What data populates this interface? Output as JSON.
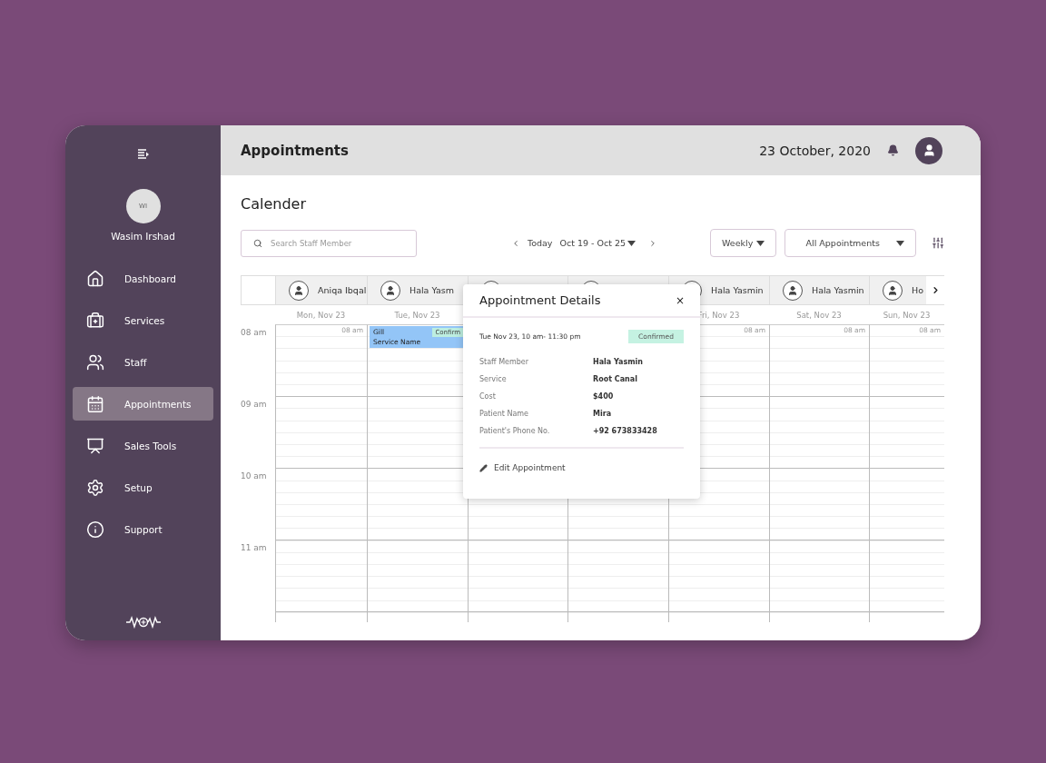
{
  "sidebar": {
    "user": {
      "initials": "WI",
      "name": "Wasim Irshad"
    },
    "items": [
      {
        "label": "Dashboard",
        "selected": false
      },
      {
        "label": "Services",
        "selected": false
      },
      {
        "label": "Staff",
        "selected": false
      },
      {
        "label": "Appointments",
        "selected": true
      },
      {
        "label": "Sales Tools",
        "selected": false
      },
      {
        "label": "Setup",
        "selected": false
      },
      {
        "label": "Support",
        "selected": false
      }
    ]
  },
  "header": {
    "title": "Appointments",
    "date": "23 October, 2020"
  },
  "page_title": "Calender",
  "toolbar": {
    "search": {
      "placeholder": "Search Staff Member"
    },
    "today": "Today",
    "range": "Oct 19 - Oct 25",
    "view": "Weekly",
    "filter": "All Appointments"
  },
  "calendar": {
    "staff": [
      {
        "kind": "named",
        "name": "Aniqa Ibqal"
      },
      {
        "kind": "named",
        "name": "Hala Yasm"
      },
      {
        "kind": "covered"
      },
      {
        "kind": "covered"
      },
      {
        "kind": "named",
        "name": "Hala Yasmin"
      },
      {
        "kind": "named",
        "name": "Hala Yasmin"
      },
      {
        "kind": "named",
        "name": "Ho"
      }
    ],
    "days": [
      {
        "kind": "visible",
        "label": "Mon, Nov 23",
        "slot_label": "08 am"
      },
      {
        "kind": "visible",
        "label": "Tue, Nov 23",
        "events": [
          {
            "title": "Gill",
            "service": "Service Name",
            "status": "Confirm"
          }
        ]
      },
      {
        "kind": "covered"
      },
      {
        "kind": "covered"
      },
      {
        "kind": "visible",
        "label": "Fri, Nov 23",
        "slot_label": "08 am"
      },
      {
        "kind": "visible",
        "label": "Sat, Nov 23",
        "slot_label": "08 am"
      },
      {
        "kind": "visible",
        "label": "Sun, Nov 23",
        "slot_label": "08 am"
      }
    ],
    "hours": [
      "08 am",
      "09 am",
      "10 am",
      "11 am"
    ]
  },
  "popup": {
    "title": "Appointment Details",
    "close": "×",
    "when": "Tue Nov 23, 10 am- 11:30 pm",
    "status": "Confirmed",
    "fields": [
      {
        "label": "Staff Member",
        "value": "Hala Yasmin"
      },
      {
        "label": "Service",
        "value": "Root Canal"
      },
      {
        "label": "Cost",
        "value": "$400"
      },
      {
        "label": "Patient Name",
        "value": "Mira"
      },
      {
        "label": "Patient's Phone No.",
        "value": "+92 673833428"
      }
    ],
    "action": "Edit Appointment"
  }
}
